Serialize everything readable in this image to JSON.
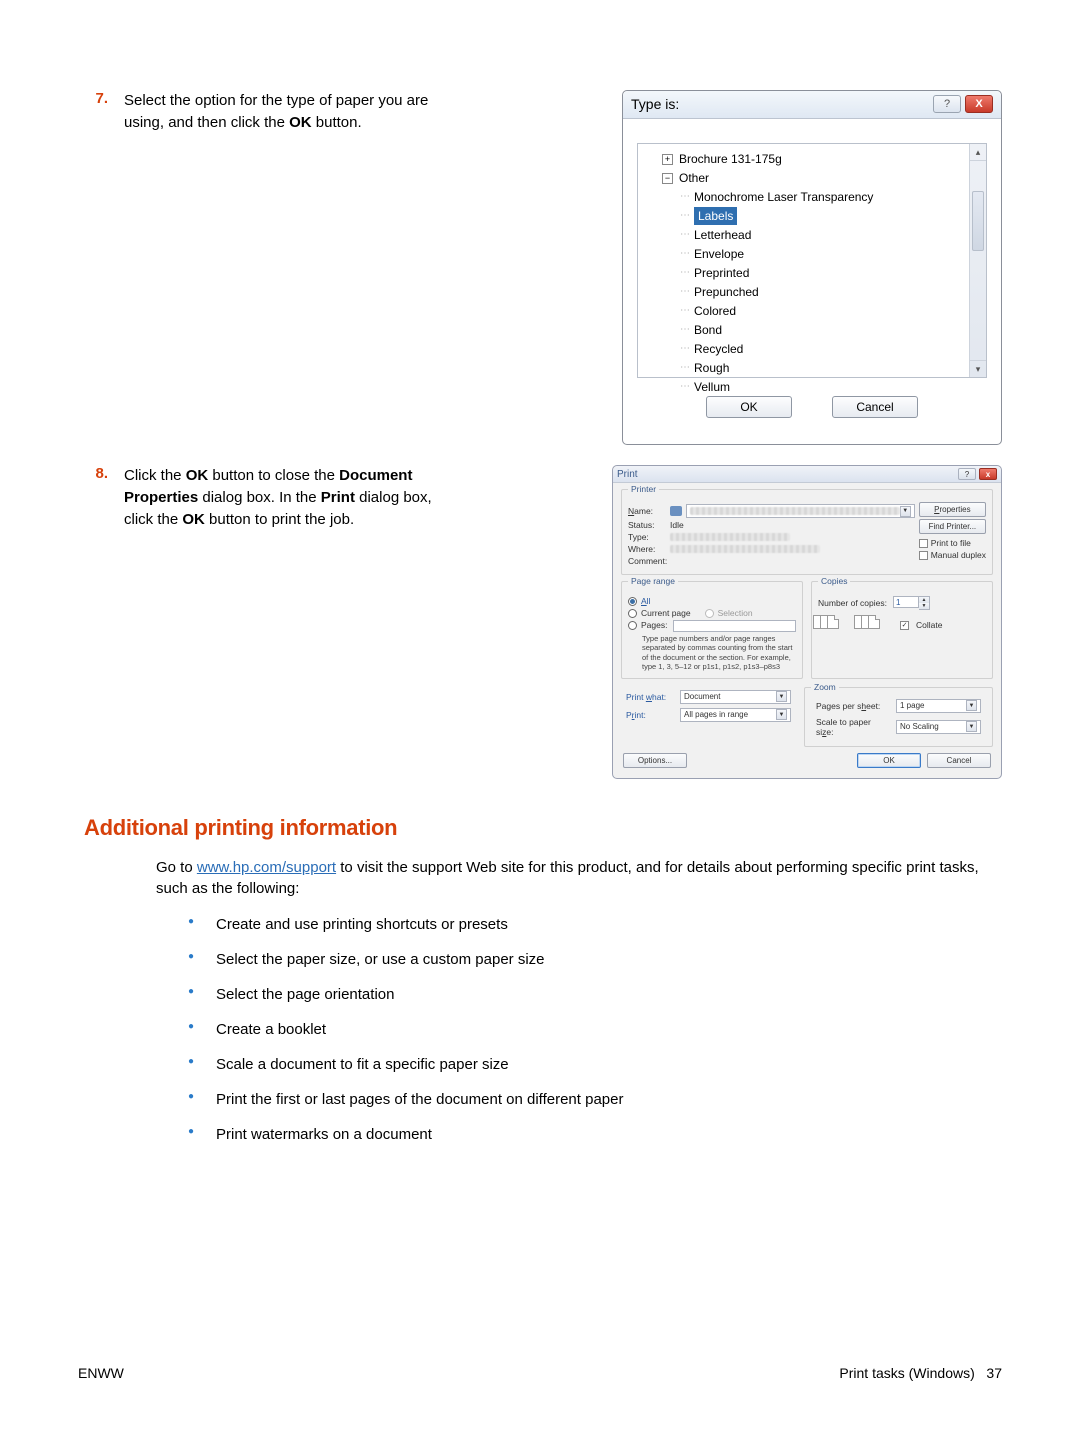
{
  "steps": {
    "s7": {
      "num": "7.",
      "text_a": "Select the option for the type of paper you are using, and then click the ",
      "ok": "OK",
      "text_b": " button."
    },
    "s8": {
      "num": "8.",
      "text_a": "Click the ",
      "ok1": "OK",
      "text_b": " button to close the ",
      "docprops": "Document Properties",
      "text_c": " dialog box. In the ",
      "print": "Print",
      "text_d": " dialog box, click the ",
      "ok2": "OK",
      "text_e": " button to print the job."
    }
  },
  "dlg_type": {
    "title": "Type is:",
    "items": {
      "brochure": "Brochure 131-175g",
      "other": "Other",
      "mono": "Monochrome Laser Transparency",
      "labels": "Labels",
      "letterhead": "Letterhead",
      "envelope": "Envelope",
      "preprinted": "Preprinted",
      "prepunched": "Prepunched",
      "colored": "Colored",
      "bond": "Bond",
      "recycled": "Recycled",
      "rough": "Rough",
      "vellum": "Vellum"
    },
    "ok": "OK",
    "cancel": "Cancel"
  },
  "dlg_print": {
    "title": "Print",
    "groups": {
      "printer": "Printer",
      "pagerange": "Page range",
      "copies": "Copies",
      "zoom": "Zoom"
    },
    "labels": {
      "name": "Name:",
      "status": "Status:",
      "type": "Type:",
      "where": "Where:",
      "comment": "Comment:",
      "all": "All",
      "current": "Current page",
      "selection": "Selection",
      "pages": "Pages:",
      "numcopies": "Number of copies:",
      "collate": "Collate",
      "printwhat": "Print what:",
      "print": "Print:",
      "pps": "Pages per sheet:",
      "sps": "Scale to paper size:"
    },
    "values": {
      "status": "Idle",
      "copies": "1",
      "printwhat": "Document",
      "print": "All pages in range",
      "pps": "1 page",
      "sps": "No Scaling"
    },
    "buttons": {
      "properties": "Properties",
      "findprinter": "Find Printer...",
      "printtofile": "Print to file",
      "manual": "Manual duplex",
      "options": "Options...",
      "ok": "OK",
      "cancel": "Cancel"
    },
    "hint": "Type page numbers and/or page ranges separated by commas counting from the start of the document or the section. For example, type 1, 3, 5–12 or p1s1, p1s2, p1s3–p8s3"
  },
  "section": {
    "heading": "Additional printing information",
    "intro_a": "Go to ",
    "link": "www.hp.com/support",
    "intro_b": " to visit the support Web site for this product, and for details about performing specific print tasks, such as the following:",
    "bullets": [
      "Create and use printing shortcuts or presets",
      "Select the paper size, or use a custom paper size",
      "Select the page orientation",
      "Create a booklet",
      "Scale a document to fit a specific paper size",
      "Print the first or last pages of the document on different paper",
      "Print watermarks on a document"
    ]
  },
  "footer": {
    "left": "ENWW",
    "right_a": "Print tasks (Windows)",
    "right_b": "37"
  }
}
